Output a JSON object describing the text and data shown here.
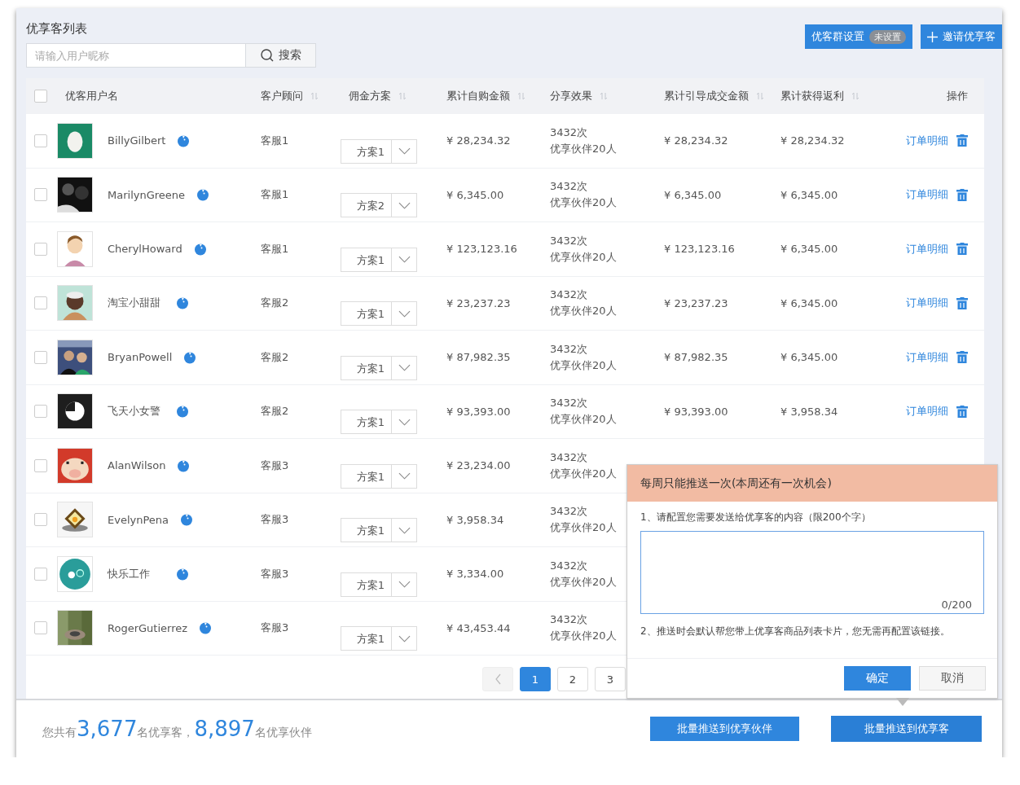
{
  "title": "优享客列表",
  "search": {
    "placeholder": "请输入用户昵称",
    "button": "搜索"
  },
  "header_buttons": [
    {
      "kind": "settings",
      "label": "优客群设置",
      "badge": "未设置"
    },
    {
      "kind": "invite",
      "label": "邀请优享客"
    }
  ],
  "table": {
    "select_all": {
      "checked": false
    },
    "columns": [
      {
        "label": "优客用户名",
        "sortable": false
      },
      {
        "label": "客户顾问",
        "sortable": true
      },
      {
        "label": "佣金方案",
        "sortable": true
      },
      {
        "label": "累计自购金额",
        "sortable": true
      },
      {
        "label": "分享效果",
        "sortable": true
      },
      {
        "label": "累计引导成交金额",
        "sortable": true
      },
      {
        "label": "累计获得返利",
        "sortable": true
      },
      {
        "label": "操作",
        "sortable": false
      }
    ],
    "rows": [
      {
        "checked": false,
        "name": "BillyGilbert",
        "advisor": "客服1",
        "plan": "方案1",
        "self_amount": "¥ 28,234.32",
        "shares": "3432次",
        "partners": "优享伙伴20人",
        "guided_amount": "¥ 28,234.32",
        "rebate": "¥ 28,234.32",
        "action": "订单明细"
      },
      {
        "checked": false,
        "name": "MarilynGreene",
        "advisor": "客服1",
        "plan": "方案2",
        "self_amount": "¥ 6,345.00",
        "shares": "3432次",
        "partners": "优享伙伴20人",
        "guided_amount": "¥ 6,345.00",
        "rebate": "¥ 6,345.00",
        "action": "订单明细"
      },
      {
        "checked": false,
        "name": "CherylHoward",
        "advisor": "客服1",
        "plan": "方案1",
        "self_amount": "¥ 123,123.16",
        "shares": "3432次",
        "partners": "优享伙伴20人",
        "guided_amount": "¥ 123,123.16",
        "rebate": "¥ 6,345.00",
        "action": "订单明细"
      },
      {
        "checked": false,
        "name": "淘宝小甜甜",
        "advisor": "客服2",
        "plan": "方案1",
        "self_amount": "¥ 23,237.23",
        "shares": "3432次",
        "partners": "优享伙伴20人",
        "guided_amount": "¥ 23,237.23",
        "rebate": "¥ 6,345.00",
        "action": "订单明细"
      },
      {
        "checked": false,
        "name": "BryanPowell",
        "advisor": "客服2",
        "plan": "方案1",
        "self_amount": "¥ 87,982.35",
        "shares": "3432次",
        "partners": "优享伙伴20人",
        "guided_amount": "¥ 87,982.35",
        "rebate": "¥ 6,345.00",
        "action": "订单明细"
      },
      {
        "checked": false,
        "name": "飞天小女警",
        "advisor": "客服2",
        "plan": "方案1",
        "self_amount": "¥ 93,393.00",
        "shares": "3432次",
        "partners": "优享伙伴20人",
        "guided_amount": "¥ 93,393.00",
        "rebate": "¥ 3,958.34",
        "action": "订单明细"
      },
      {
        "checked": false,
        "name": "AlanWilson",
        "advisor": "客服3",
        "plan": "方案1",
        "self_amount": "¥ 23,234.00",
        "shares": "3432次",
        "partners": "优享伙伴20人"
      },
      {
        "checked": false,
        "name": "EvelynPena",
        "advisor": "客服3",
        "plan": "方案1",
        "self_amount": "¥ 3,958.34",
        "shares": "3432次",
        "partners": "优享伙伴20人"
      },
      {
        "checked": false,
        "name": "快乐工作",
        "advisor": "客服3",
        "plan": "方案1",
        "self_amount": "¥ 3,334.00",
        "shares": "3432次",
        "partners": "优享伙伴20人"
      },
      {
        "checked": false,
        "name": "RogerGutierrez",
        "advisor": "客服3",
        "plan": "方案1",
        "self_amount": "¥ 43,453.44",
        "shares": "3432次",
        "partners": "优享伙伴20人"
      }
    ]
  },
  "pagination": {
    "prev_disabled": true,
    "pages": [
      {
        "label": "1",
        "selected": true
      },
      {
        "label": "2",
        "selected": false
      },
      {
        "label": "3",
        "selected": false
      }
    ]
  },
  "summary": {
    "prefix": "您共有",
    "customers": "3,677",
    "middle": "名优享客，",
    "partners": "8,897",
    "suffix": "名优享伙伴"
  },
  "footer_buttons": [
    {
      "label": "批量推送到优享伙伴",
      "selected": false
    },
    {
      "label": "批量推送到优享客",
      "selected": true
    }
  ],
  "popup": {
    "title": "每周只能推送一次(本周还有一次机会)",
    "step_1": "1、请配置您需要发送给优享客的内容（限200个字）",
    "counter": "0/200",
    "step_2": "2、推送时会默认帮您带上优享客商品列表卡片，您无需再配置该链接。",
    "buttons": [
      {
        "kind": "primary",
        "label": "确定"
      },
      {
        "kind": "secondary",
        "label": "取消"
      }
    ]
  }
}
